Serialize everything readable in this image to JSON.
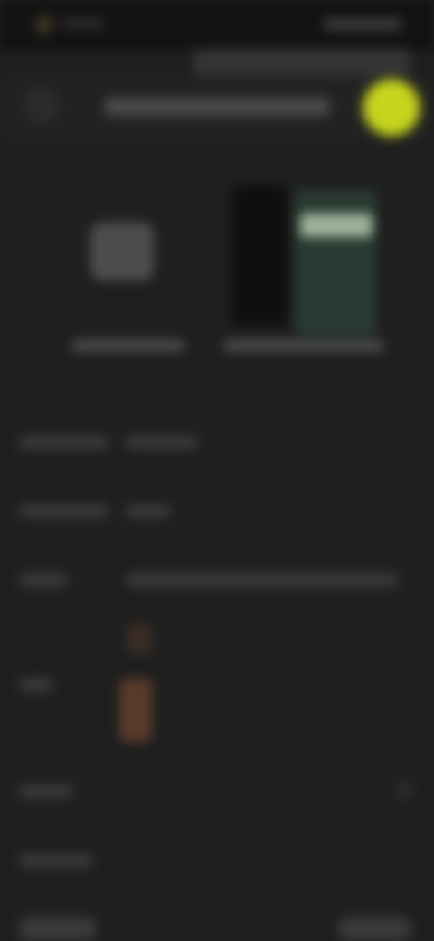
{
  "status_bar": {
    "time": "",
    "right_indicators": ""
  },
  "notice": {
    "text": ""
  },
  "header": {
    "title": ""
  },
  "media": {
    "left_caption": "",
    "right_caption": ""
  },
  "details": {
    "row1_label": "",
    "row1_value": "",
    "row2_label": "",
    "row2_value": "",
    "row3_label": "",
    "row3_value": "",
    "row4_label": "",
    "row5_label": "",
    "row6_label": "",
    "bottom_left_label": "",
    "bottom_right_button": ""
  },
  "colors": {
    "background": "#1f1f1f",
    "accent_avatar": "#c7d41d",
    "media_right": "#2a3a32"
  },
  "icons": {
    "back": "back-icon",
    "avatar": "avatar-icon",
    "chevron": "chevron-right-icon"
  }
}
